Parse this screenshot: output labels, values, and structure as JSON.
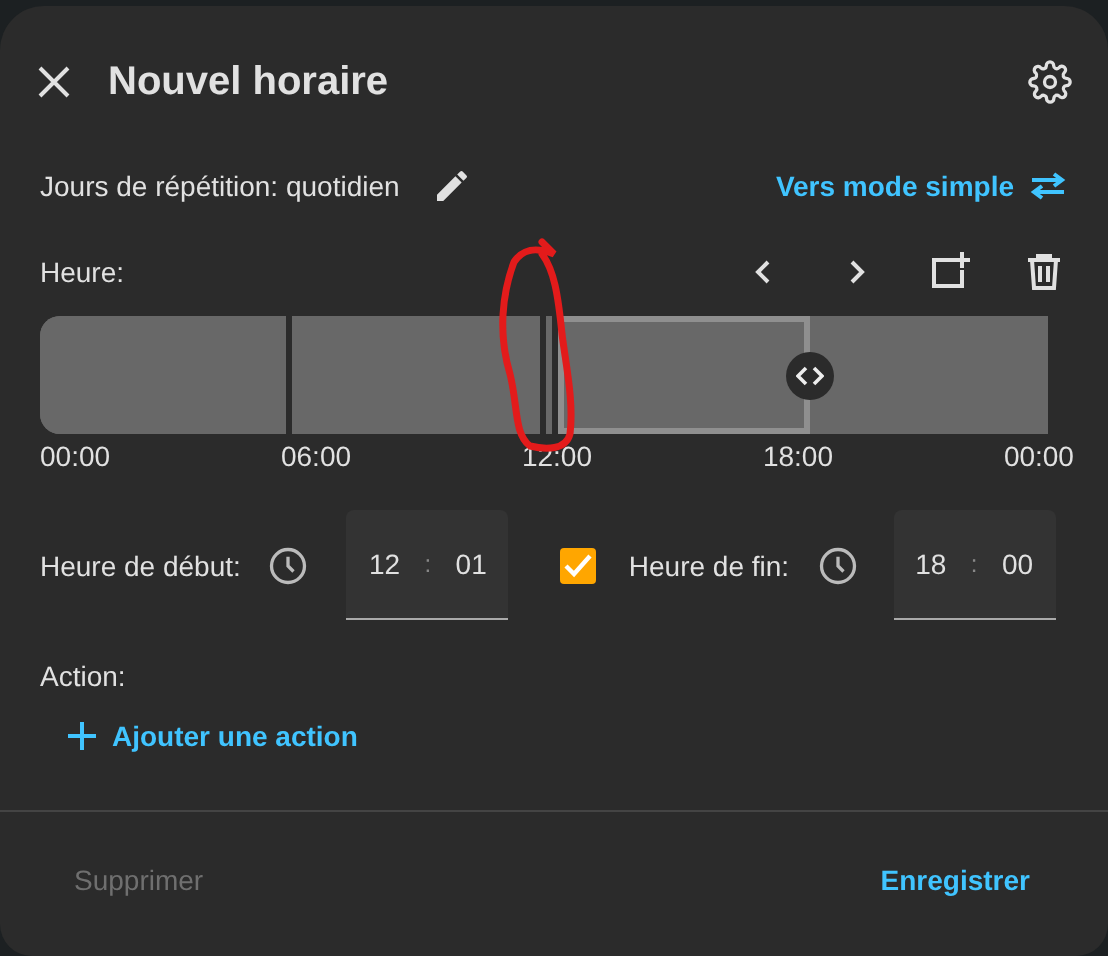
{
  "dialog": {
    "title": "Nouvel horaire"
  },
  "repeat": {
    "label": "Jours de répétition: quotidien",
    "mode_link": "Vers mode simple"
  },
  "timeline": {
    "label": "Heure:",
    "segments": [
      {
        "selected": false
      },
      {
        "selected": false
      },
      {
        "selected": false
      },
      {
        "selected": true
      },
      {
        "selected": false
      }
    ],
    "ticks": [
      "00:00",
      "06:00",
      "12:00",
      "18:00",
      "00:00"
    ]
  },
  "start": {
    "label": "Heure de début:",
    "hours": "12",
    "separator": ":",
    "minutes": "01"
  },
  "end": {
    "enabled": true,
    "label": "Heure de fin:",
    "hours": "18",
    "separator": ":",
    "minutes": "00"
  },
  "action": {
    "label": "Action:",
    "add": "Ajouter une action"
  },
  "footer": {
    "delete": "Supprimer",
    "delete_disabled": true,
    "save": "Enregistrer"
  }
}
